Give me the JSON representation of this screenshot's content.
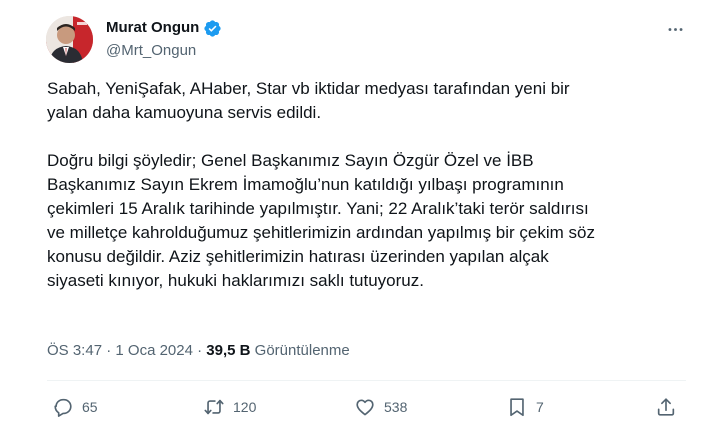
{
  "author": {
    "display_name": "Murat Ongun",
    "handle": "@Mrt_Ongun",
    "verified": true,
    "verified_color": "#1d9bf0"
  },
  "tweet": {
    "paragraph1_lines": [
      "Sabah, YeniŞafak, AHaber, Star vb iktidar medyası tarafından yeni bir",
      "yalan daha kamuoyuna servis edildi."
    ],
    "paragraph2_lines": [
      "Doğru bilgi şöyledir;  Genel Başkanımız Sayın Özgür Özel ve İBB",
      "Başkanımız Sayın Ekrem İmamoğlu’nun katıldığı yılbaşı programının",
      "çekimleri 15 Aralık tarihinde yapılmıştır. Yani; 22 Aralık’taki terör saldırısı",
      "ve milletçe kahrolduğumuz şehitlerimizin ardından yapılmış bir çekim söz",
      "konusu değildir. Aziz şehitlerimizin hatırası üzerinden yapılan alçak",
      "siyaseti kınıyor, hukuki haklarımızı saklı tutuyoruz."
    ]
  },
  "meta": {
    "time": "ÖS 3:47",
    "separator": " · ",
    "date": "1 Oca 2024",
    "views_count": "39,5 B",
    "views_label": "Görüntülenme"
  },
  "actions": {
    "reply_count": "65",
    "retweet_count": "120",
    "like_count": "538",
    "bookmark_count": "7"
  },
  "icons": {
    "reply": "reply-icon",
    "retweet": "retweet-icon",
    "like": "heart-icon",
    "bookmark": "bookmark-icon",
    "share": "share-icon",
    "more": "more-dots-icon"
  }
}
